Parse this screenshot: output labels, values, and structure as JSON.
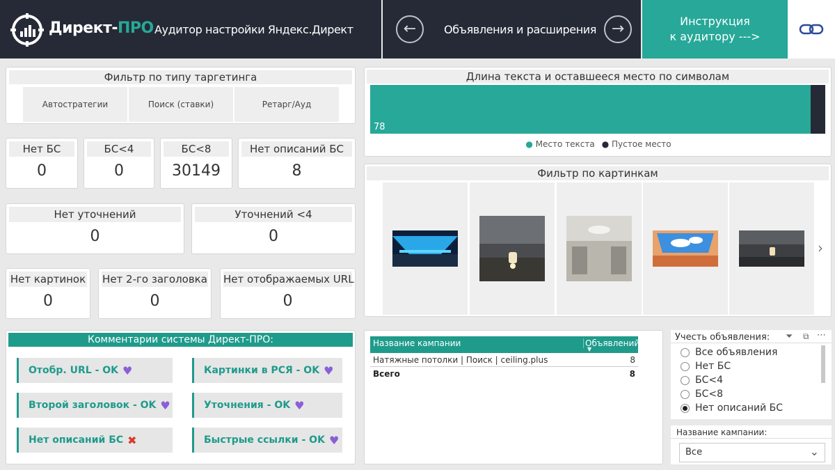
{
  "header": {
    "brand_main": "Директ-",
    "brand_accent": "ПРО",
    "subtitle": "Аудитор настройки Яндекс.Директ",
    "nav_label": "Объявления и расширения",
    "prev_icon": "arrow-left-icon",
    "next_icon": "arrow-right-icon",
    "instruction_line1": "Инструкция",
    "instruction_line2": "к аудитору --->",
    "link_icon": "link-icon"
  },
  "targeting_filter": {
    "title": "Фильтр по типу таргетинга",
    "options": [
      "Автостратегии",
      "Поиск (ставки)",
      "Ретарг/Ауд"
    ]
  },
  "kpis_row1": [
    {
      "label": "Нет БС",
      "value": "0"
    },
    {
      "label": "БС<4",
      "value": "0"
    },
    {
      "label": "БС<8",
      "value": "30149"
    },
    {
      "label": "Нет описаний БС",
      "value": "8"
    }
  ],
  "kpis_row2": [
    {
      "label": "Нет уточнений",
      "value": "0"
    },
    {
      "label": "Уточнений <4",
      "value": "0"
    }
  ],
  "kpis_row3": [
    {
      "label": "Нет картинок",
      "value": "0"
    },
    {
      "label": "Нет 2-го заголовка",
      "value": "0"
    },
    {
      "label": "Нет отображаемых URL",
      "value": "0"
    }
  ],
  "text_length_chart": {
    "title": "Длина текста и оставшееся место по символам",
    "legend": [
      "Место текста",
      "Пустое место"
    ]
  },
  "chart_data": {
    "type": "bar",
    "orientation": "horizontal-stacked",
    "title": "Длина текста и оставшееся место по символам",
    "series": [
      {
        "name": "Место текста",
        "values": [
          78
        ],
        "color": "#27a898"
      },
      {
        "name": "Пустое место",
        "values": [
          2.6
        ],
        "color": "#252a36"
      }
    ],
    "data_labels": [
      "78"
    ],
    "legend_position": "bottom"
  },
  "image_filter": {
    "title": "Фильтр по картинкам",
    "next_icon": "chevron-right-icon"
  },
  "comments": {
    "title": "Комментарии системы Директ-ПРО:",
    "left": [
      {
        "text": "Отобр. URL - OK",
        "icon": "heart-icon",
        "glyph": "♥"
      },
      {
        "text": "Второй заголовок - OK",
        "icon": "heart-icon",
        "glyph": "♥"
      },
      {
        "text": "Нет описаний БС",
        "icon": "cross-icon",
        "glyph": "✖"
      }
    ],
    "right": [
      {
        "text": "Картинки в РСЯ - OK",
        "icon": "heart-icon",
        "glyph": "♥"
      },
      {
        "text": "Уточнения - OK",
        "icon": "heart-icon",
        "glyph": "♥"
      },
      {
        "text": "Быстрые ссылки - OK",
        "icon": "heart-icon",
        "glyph": "♥"
      }
    ]
  },
  "campaign_table": {
    "headers": [
      "Название кампании",
      "Объявлений"
    ],
    "rows": [
      {
        "name": "Натяжные потолки | Поиск | ceiling.plus",
        "count": "8"
      }
    ],
    "total_label": "Всего",
    "total_value": "8"
  },
  "ad_slicer": {
    "title": "Учесть объявления:",
    "options": [
      "Все объявления",
      "Нет БС",
      "БС<4",
      "БС<8",
      "Нет описаний БС"
    ],
    "selected": "Нет описаний БС"
  },
  "campaign_slicer": {
    "title": "Название кампании:",
    "value": "Все"
  },
  "colors": {
    "teal": "#27a898",
    "dark": "#252a36",
    "heart": "#8a60d6",
    "cross": "#d63a2a"
  }
}
